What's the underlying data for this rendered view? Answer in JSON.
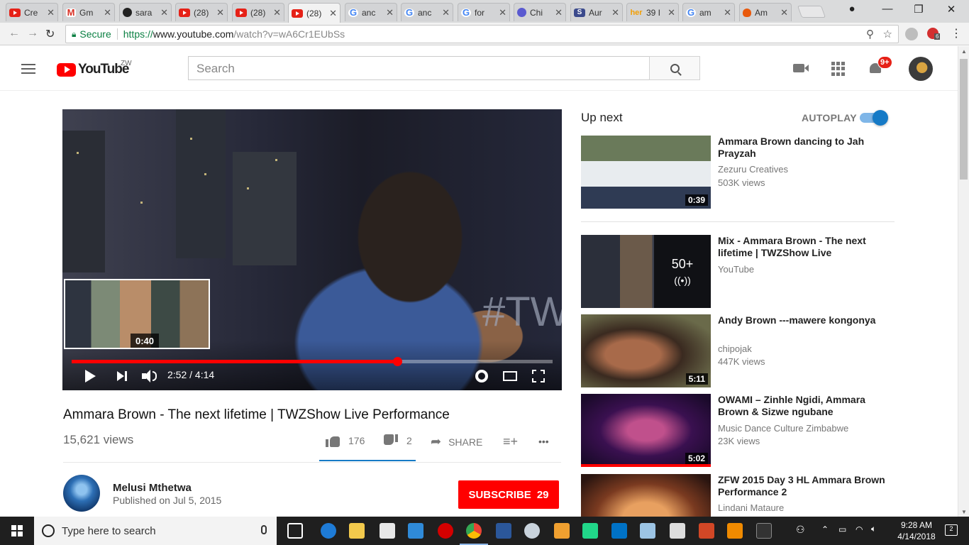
{
  "browser": {
    "tabs": [
      {
        "icon": "youtube-icon",
        "label": "Cre"
      },
      {
        "icon": "gmail-icon",
        "label": "Gm"
      },
      {
        "icon": "github-icon",
        "label": "sara"
      },
      {
        "icon": "youtube-icon",
        "label": "(28)"
      },
      {
        "icon": "youtube-icon",
        "label": "(28)"
      },
      {
        "icon": "youtube-icon",
        "label": "(28)"
      },
      {
        "icon": "google-icon",
        "label": "anc"
      },
      {
        "icon": "google-icon",
        "label": "anc"
      },
      {
        "icon": "google-icon",
        "label": "for"
      },
      {
        "icon": "chrome-web-icon",
        "label": "Chi"
      },
      {
        "icon": "slides-icon",
        "label": "Aur"
      },
      {
        "icon": "her-icon",
        "label": "39 I"
      },
      {
        "icon": "google-icon",
        "label": "am"
      },
      {
        "icon": "fire-icon",
        "label": "Am"
      }
    ],
    "close_glyph": "✕",
    "favicon_text": {
      "gmail": "M",
      "google": "G",
      "slides": "S",
      "her": "her"
    },
    "address": {
      "secure_label": "Secure",
      "url_proto": "https://",
      "url_host": "www.youtube.com",
      "url_rest": "/watch?v=wA6Cr1EUbSs"
    },
    "ext_badge": "6"
  },
  "youtube": {
    "logo_text": "YouTube",
    "country_code": "ZW",
    "search_placeholder": "Search",
    "notification_count": "9+"
  },
  "player": {
    "current_time": "2:52",
    "duration": "4:14",
    "time_display": "2:52 / 4:14",
    "progress_fraction": 0.677,
    "scrub_preview_time": "0:40",
    "overlay_text": "#TW"
  },
  "video": {
    "title": "Ammara Brown - The next lifetime | TWZShow Live Performance",
    "views": "15,621 views",
    "likes": "176",
    "dislikes": "2",
    "share_label": "SHARE",
    "more_label": "•••"
  },
  "channel": {
    "name": "Melusi Mthetwa",
    "published": "Published on Jul 5, 2015",
    "subscribe_label": "SUBSCRIBE",
    "subscriber_count": "29"
  },
  "sidebar": {
    "up_next_label": "Up next",
    "autoplay_label": "AUTOPLAY",
    "autoplay_on": true,
    "recommendations": [
      {
        "title": "Ammara Brown dancing to Jah Prayzah",
        "channel": "Zezuru Creatives",
        "views": "503K views",
        "duration": "0:39"
      },
      {
        "title": "Mix - Ammara Brown - The next lifetime | TWZShow Live",
        "channel": "YouTube",
        "views": "",
        "duration": "",
        "mix_count": "50+",
        "mix_glyph": "((•))"
      },
      {
        "title": "Andy Brown ---mawere kongonya",
        "channel": "chipojak",
        "views": "447K views",
        "duration": "5:11"
      },
      {
        "title": "OWAMI – Zinhle Ngidi, Ammara Brown & Sizwe ngubane",
        "channel": "Music Dance Culture Zimbabwe",
        "views": "23K views",
        "duration": "5:02"
      },
      {
        "title": "ZFW 2015 Day 3 HL Ammara Brown Performance 2",
        "channel": "Lindani Mataure",
        "views": "",
        "duration": ""
      }
    ]
  },
  "taskbar": {
    "search_placeholder": "Type here to search",
    "time": "9:28 AM",
    "date": "4/14/2018",
    "notification_count": "2"
  },
  "colors": {
    "youtube_red": "#ff0000",
    "secure_green": "#0b8043",
    "link_blue": "#167ac6"
  }
}
